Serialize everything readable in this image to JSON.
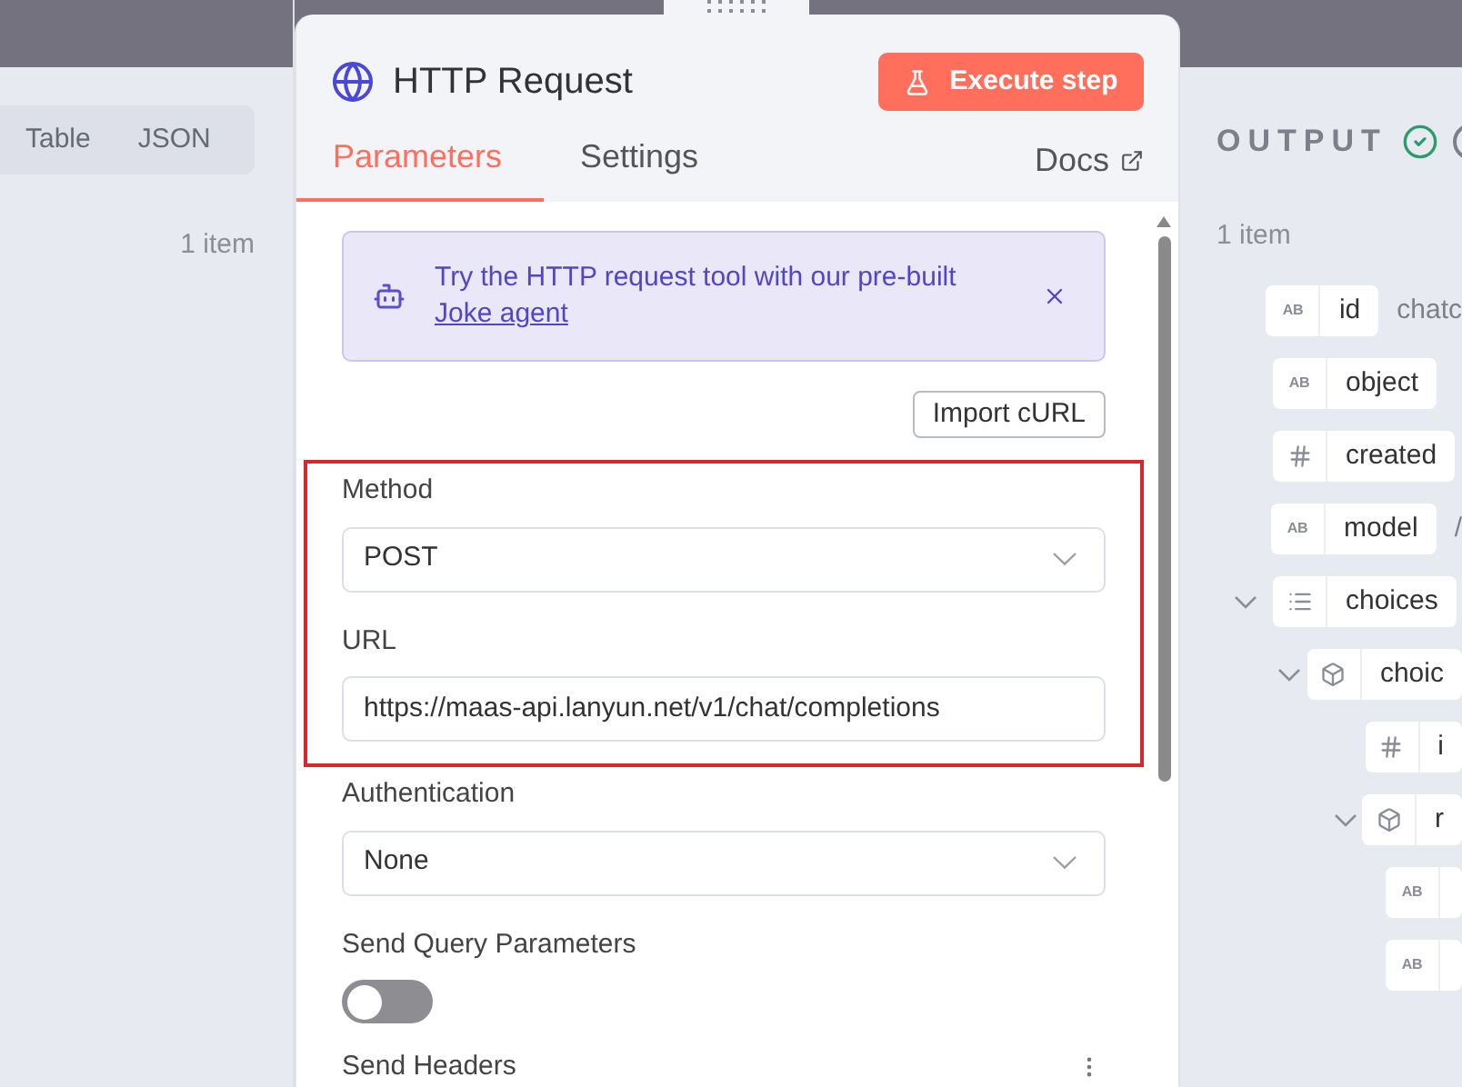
{
  "input_panel": {
    "view_tabs": [
      {
        "label": "Table",
        "selected": false
      },
      {
        "label": "JSON",
        "selected": false
      }
    ],
    "count": "1 item"
  },
  "node": {
    "title": "HTTP Request",
    "execute_button": "Execute step",
    "tabs": [
      {
        "label": "Parameters",
        "selected": true
      },
      {
        "label": "Settings",
        "selected": false
      }
    ],
    "docs_link": "Docs",
    "banner": {
      "text": "Try the HTTP request tool with our pre-built",
      "link": "Joke agent"
    },
    "import_button": "Import cURL",
    "sections": [
      {
        "highlighted": true,
        "fields": [
          {
            "kind": "select",
            "label": "Method",
            "value": "POST"
          },
          {
            "kind": "input",
            "label": "URL",
            "value": "https://maas-api.lanyun.net/v1/chat/completions"
          }
        ]
      },
      {
        "highlighted": false,
        "fields": [
          {
            "kind": "select",
            "label": "Authentication",
            "value": "None"
          },
          {
            "kind": "toggle",
            "label": "Send Query Parameters",
            "on": false
          },
          {
            "kind": "label",
            "label": "Send Headers"
          }
        ]
      }
    ]
  },
  "output_panel": {
    "title": "OUTPUT",
    "count": "1 item",
    "tree": [
      {
        "kind": "string",
        "type_icon": "AB",
        "name": "id",
        "value": "chatc"
      },
      {
        "kind": "string",
        "type_icon": "AB",
        "name": "object"
      },
      {
        "kind": "number",
        "name": "created"
      },
      {
        "kind": "string",
        "type_icon": "AB",
        "name": "model",
        "value": "/"
      },
      {
        "kind": "array",
        "name": "choices",
        "expanded": true,
        "children": [
          {
            "kind": "object",
            "name": "choic",
            "expanded": true,
            "children": [
              {
                "kind": "number",
                "name": "i"
              },
              {
                "kind": "object",
                "name": "r",
                "expanded": true,
                "children": [
                  {
                    "kind": "string",
                    "type_icon": "AB"
                  },
                  {
                    "kind": "string",
                    "type_icon": "AB"
                  }
                ]
              }
            ]
          }
        ]
      }
    ]
  }
}
